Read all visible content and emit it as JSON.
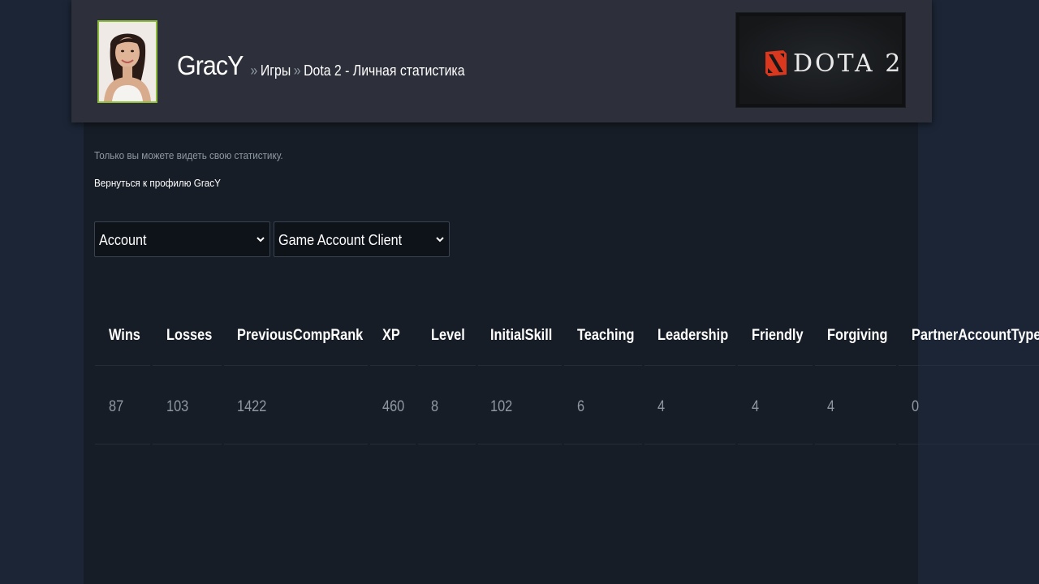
{
  "header": {
    "persona_name": "GracY",
    "breadcrumb": {
      "separator": "»",
      "items": [
        "Игры",
        "Dota 2 - Личная статистика"
      ]
    },
    "game_logo_text": "DOTA 2"
  },
  "notice": {
    "private_text": "Только вы можете видеть свою статистику.",
    "back_link": "Вернуться к профилю GracY"
  },
  "filters": {
    "category": {
      "selected": "Account"
    },
    "subcategory": {
      "selected": "Game Account Client"
    }
  },
  "stats": {
    "columns": [
      "Wins",
      "Losses",
      "PreviousCompRank",
      "XP",
      "Level",
      "InitialSkill",
      "Teaching",
      "Leadership",
      "Friendly",
      "Forgiving",
      "PartnerAccountType"
    ],
    "values": [
      "87",
      "103",
      "1422",
      "460",
      "8",
      "102",
      "6",
      "4",
      "4",
      "4",
      "0"
    ]
  },
  "colors": {
    "page_bg": "#1b2535",
    "header_bg": "#2d303b",
    "panel_bg": "#171d27",
    "avatar_border": "#8dbb3b",
    "muted_text": "#8f98a0",
    "dota_red": "#d9381e"
  },
  "icons": {
    "avatar": "user-avatar-photo",
    "game_logo": "dota2-logo",
    "dropdown": "chevron-down-icon"
  }
}
